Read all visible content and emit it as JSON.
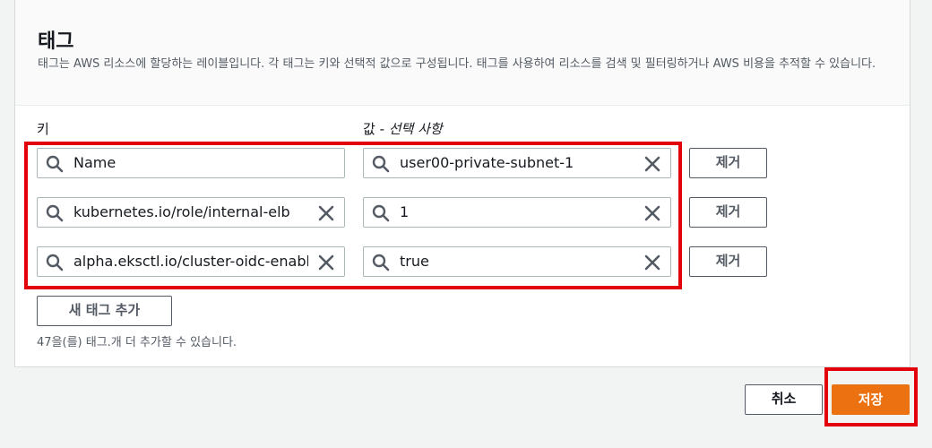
{
  "section": {
    "title": "태그",
    "description": "태그는 AWS 리소스에 할당하는 레이블입니다. 각 태그는 키와 선택적 값으로 구성됩니다. 태그를 사용하여 리소스를 검색 및 필터링하거나 AWS 비용을 추적할 수 있습니다."
  },
  "columns": {
    "key_label": "키",
    "value_label": "값 - ",
    "value_optional": "선택 사항"
  },
  "tags": [
    {
      "key": "Name",
      "value": "user00-private-subnet-1",
      "key_clearable": false,
      "remove_label": "제거"
    },
    {
      "key": "kubernetes.io/role/internal-elb",
      "value": "1",
      "key_clearable": true,
      "remove_label": "제거"
    },
    {
      "key": "alpha.eksctl.io/cluster-oidc-enabled",
      "value": "true",
      "key_clearable": true,
      "remove_label": "제거"
    }
  ],
  "add_tag_label": "새 태그 추가",
  "limit_note": "47을(를) 태그.개 더 추가할 수 있습니다.",
  "footer": {
    "cancel_label": "취소",
    "save_label": "저장"
  },
  "colors": {
    "primary": "#ec7211",
    "highlight": "#e3000b"
  }
}
